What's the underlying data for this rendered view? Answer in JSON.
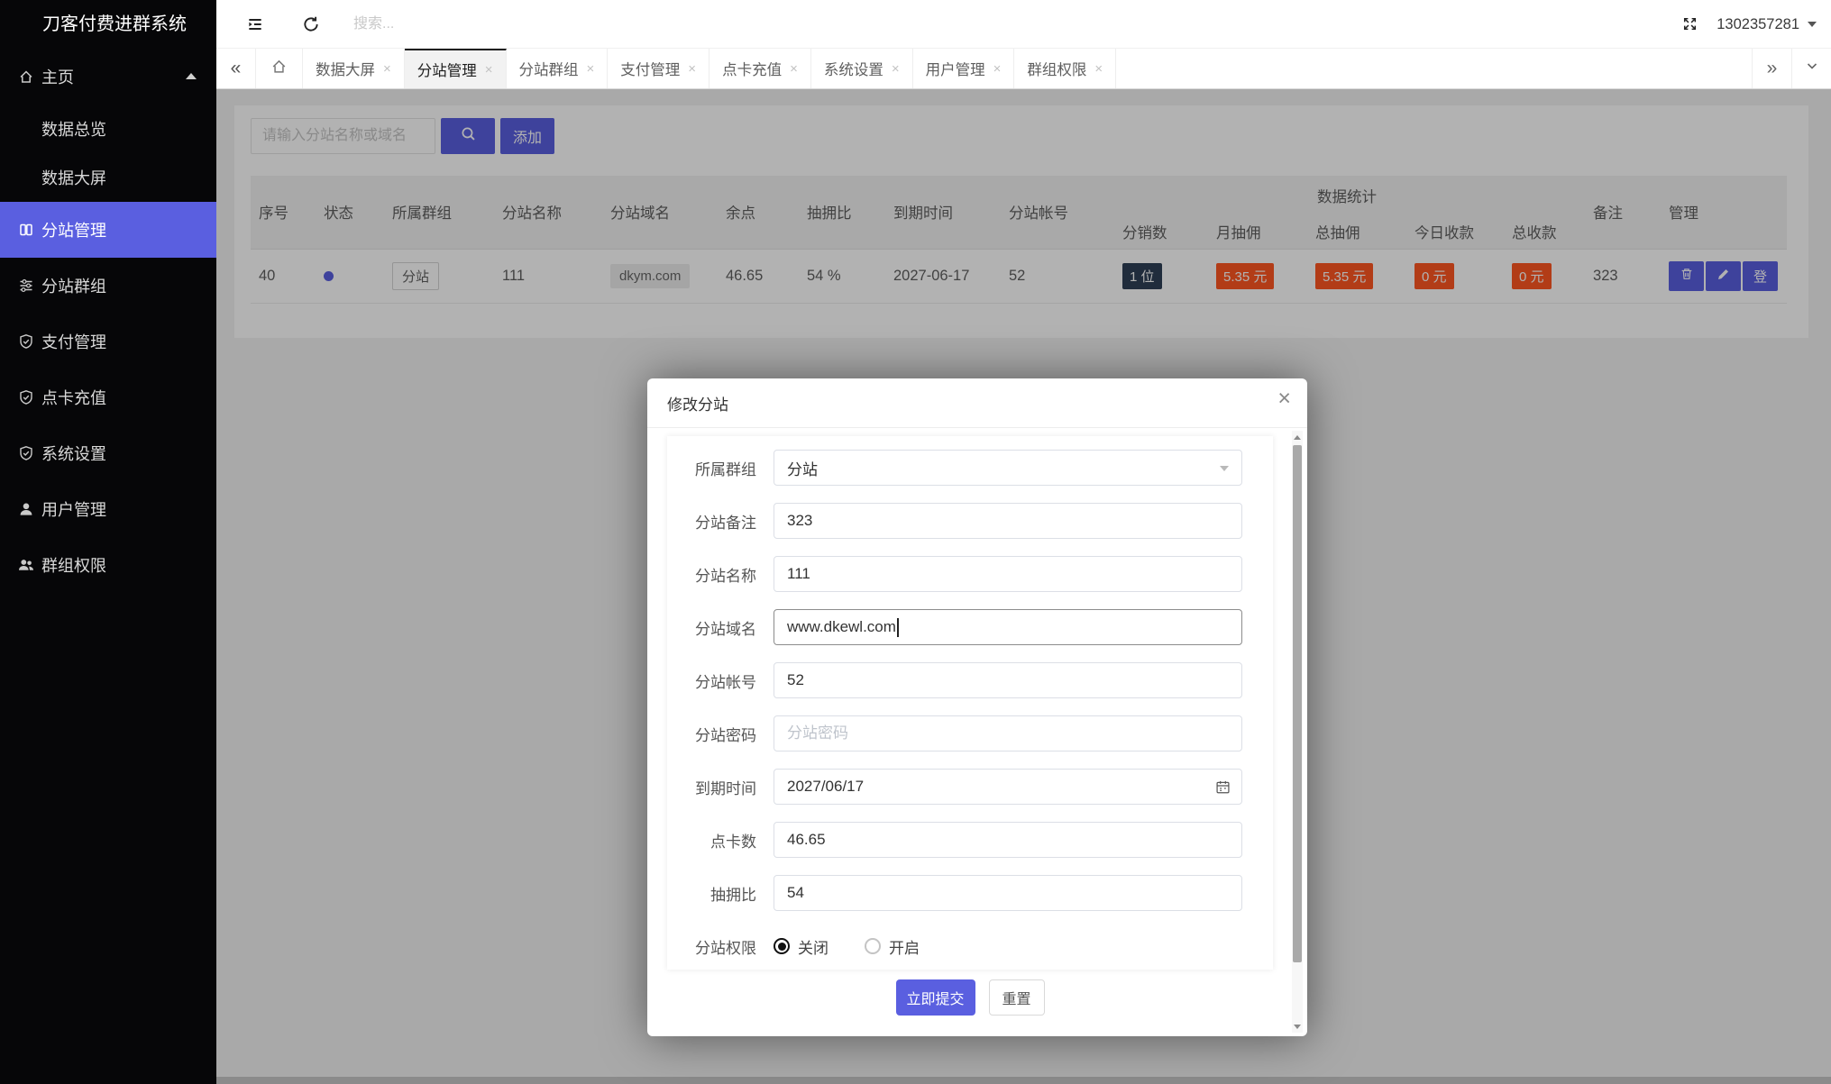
{
  "colors": {
    "accent": "#5a5fe0",
    "badge_red": "#ff5722",
    "badge_cyan": "#2f4056",
    "sidebar_bg": "#060608"
  },
  "icons": {
    "home-icon": "house outline",
    "columns-icon": "two columns",
    "sliders-icon": "sliders",
    "shield-check-icon": "shield with check",
    "user-icon": "person",
    "users-icon": "two people",
    "collapse-menu-icon": "hamburger with left arrow",
    "refresh-icon": "circular arrow",
    "fullscreen-icon": "expand arrows",
    "caret-up-icon": "▲",
    "caret-down-icon": "▼",
    "chevrons-left": "«",
    "chevrons-right": "»",
    "chevron-down-icon": "˅",
    "close-icon": "×",
    "search-icon": "magnifier",
    "trash-icon": "trash can",
    "edit-icon": "pencil",
    "calendar-icon": "calendar",
    "status-dot": "●"
  },
  "sidebar": {
    "title": "刀客付费进群系统",
    "items": [
      {
        "label": "主页"
      },
      {
        "label": "数据总览"
      },
      {
        "label": "数据大屏"
      },
      {
        "label": "分站管理",
        "active": true
      },
      {
        "label": "分站群组"
      },
      {
        "label": "支付管理"
      },
      {
        "label": "点卡充值"
      },
      {
        "label": "系统设置"
      },
      {
        "label": "用户管理"
      },
      {
        "label": "群组权限"
      }
    ]
  },
  "topbar": {
    "search_placeholder": "搜索...",
    "username": "1302357281"
  },
  "tabbar": {
    "collapse_left": "«",
    "expand_right": "»",
    "close_glyph": "×",
    "tabs": [
      {
        "label": "数据大屏"
      },
      {
        "label": "分站管理",
        "active": true
      },
      {
        "label": "分站群组"
      },
      {
        "label": "支付管理"
      },
      {
        "label": "点卡充值"
      },
      {
        "label": "系统设置"
      },
      {
        "label": "用户管理"
      },
      {
        "label": "群组权限"
      }
    ]
  },
  "toolbar": {
    "search_placeholder": "请输入分站名称或域名",
    "add_label": "添加"
  },
  "table": {
    "headers": [
      "序号",
      "状态",
      "所属群组",
      "分站名称",
      "分站域名",
      "余点",
      "抽拥比",
      "到期时间",
      "分站帐号"
    ],
    "stats_group_label": "数据统计",
    "stats_headers": [
      "分销数",
      "月抽佣",
      "总抽佣",
      "今日收款",
      "总收款"
    ],
    "tail_headers": [
      "备注",
      "管理"
    ],
    "row": {
      "seq": "40",
      "group_tag": "分站",
      "site_name": "111",
      "site_domain": "dkym.com",
      "balance": "46.65",
      "commission": "54 %",
      "expire": "2027-06-17",
      "account": "52",
      "distributors": "1 位",
      "month_commission": "5.35 元",
      "total_commission": "5.35 元",
      "today_income": "0 元",
      "total_income": "0 元",
      "remark": "323",
      "login_label": "登"
    }
  },
  "modal": {
    "title": "修改分站",
    "close_glyph": "×",
    "fields": {
      "group": {
        "label": "所属群组",
        "value": "分站"
      },
      "remark": {
        "label": "分站备注",
        "value": "323"
      },
      "name": {
        "label": "分站名称",
        "value": "111"
      },
      "domain": {
        "label": "分站域名",
        "value": "www.dkewl.com"
      },
      "account": {
        "label": "分站帐号",
        "value": "52"
      },
      "password": {
        "label": "分站密码",
        "placeholder": "分站密码"
      },
      "expire": {
        "label": "到期时间",
        "value": "2027/06/17"
      },
      "points": {
        "label": "点卡数",
        "value": "46.65"
      },
      "commission": {
        "label": "抽拥比",
        "value": "54"
      },
      "permission": {
        "label": "分站权限",
        "options": [
          {
            "label": "关闭",
            "selected": true
          },
          {
            "label": "开启",
            "selected": false
          }
        ]
      }
    },
    "submit_label": "立即提交",
    "reset_label": "重置"
  }
}
